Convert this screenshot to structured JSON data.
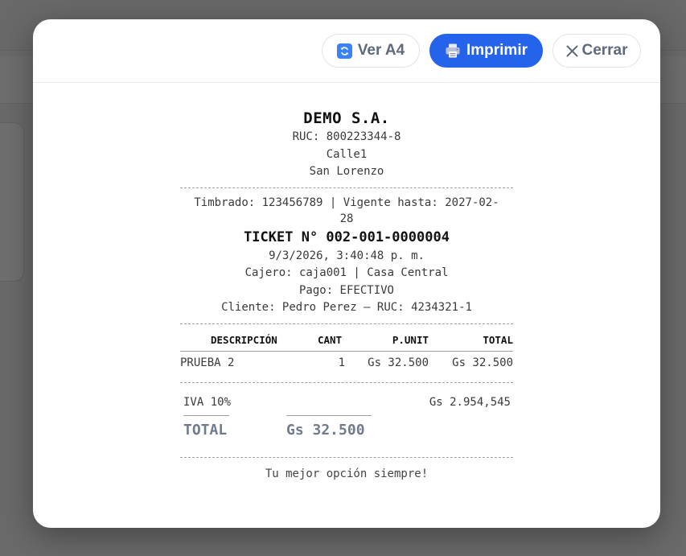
{
  "toolbar": {
    "view_a4_label": "Ver A4",
    "print_label": "Imprimir",
    "close_label": "Cerrar"
  },
  "receipt": {
    "company": "DEMO S.A.",
    "ruc": "RUC: 800223344-8",
    "address": "Calle1",
    "city": "San Lorenzo",
    "timbrado_line1": "Timbrado: 123456789 | Vigente hasta: 2027-02-",
    "timbrado_line2": "28",
    "ticket_title": "TICKET N° 002-001-0000004",
    "datetime": "9/3/2026, 3:40:48 p. m.",
    "cashier": "Cajero: caja001 | Casa Central",
    "payment": "Pago: EFECTIVO",
    "customer": "Cliente: Pedro Perez — RUC: 4234321-1",
    "columns": {
      "description": "DESCRIPCIÓN",
      "quantity": "CANT",
      "unit_price": "P.UNIT",
      "total": "TOTAL"
    },
    "items": [
      {
        "description": "PRUEBA 2",
        "quantity": "1",
        "unit_price": "Gs 32.500",
        "total": "Gs 32.500"
      }
    ],
    "iva_label": "IVA 10%",
    "iva_value": "Gs 2.954,545",
    "total_label": "TOTAL",
    "total_value": "Gs 32.500",
    "footer": "Tu mejor opción siempre!"
  },
  "colors": {
    "primary": "#2563eb",
    "muted_text": "#5e6a7c",
    "total_text": "#707c8e"
  }
}
